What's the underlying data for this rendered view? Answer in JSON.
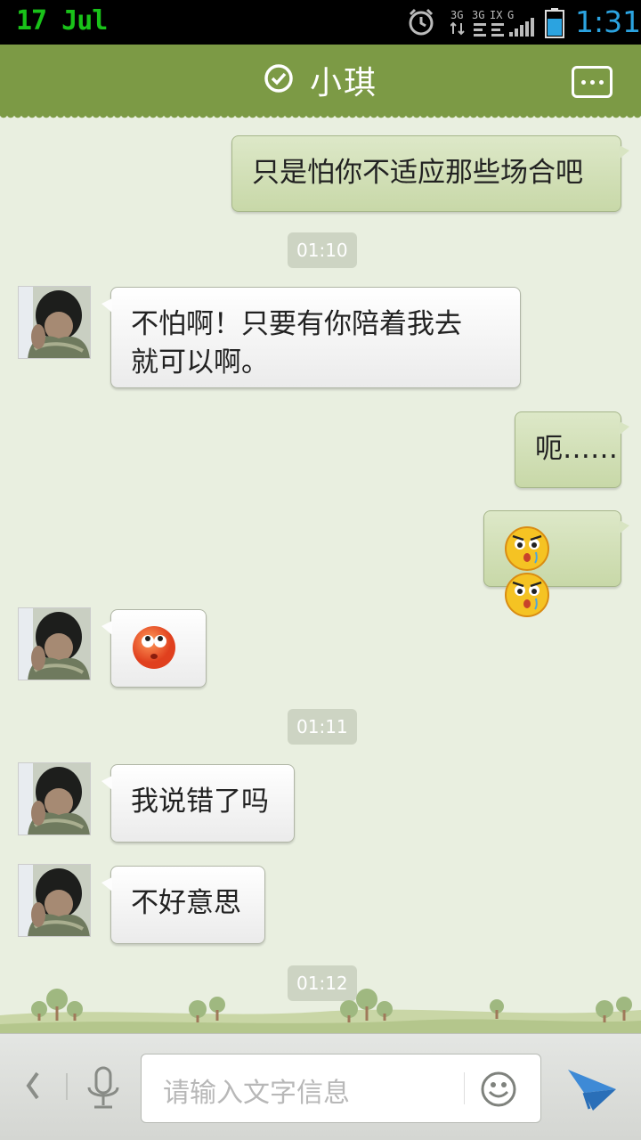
{
  "status_bar": {
    "date": "17  Jul",
    "time": "1:31",
    "network_label": "3G",
    "icons": [
      "alarm-icon",
      "network-icon",
      "signal-icon",
      "battery-icon"
    ]
  },
  "header": {
    "title": "小琪",
    "verified_icon": "check-circle-icon",
    "menu_icon": "more-icon"
  },
  "messages": [
    {
      "dir": "out",
      "text": "只是怕你不适应那些场合吧"
    },
    {
      "time": "01:10"
    },
    {
      "dir": "in",
      "text": "不怕啊！只要有你陪着我去就可以啊。"
    },
    {
      "dir": "out",
      "text": "呃……"
    },
    {
      "dir": "out",
      "emoji": [
        "angry-face-emoji",
        "angry-face-emoji"
      ]
    },
    {
      "dir": "in",
      "emoji": [
        "rolling-eyes-emoji"
      ]
    },
    {
      "time": "01:11"
    },
    {
      "dir": "in",
      "text": "我说错了吗"
    },
    {
      "dir": "in",
      "text": "不好意思"
    },
    {
      "time": "01:12"
    }
  ],
  "texts": {
    "m1": "只是怕你不适应那些场合吧",
    "ts1": "01:10",
    "m2_line1": "不怕啊！只要有你陪着我去",
    "m2_line2": "就可以啊。",
    "m3": "呃……",
    "ts2": "01:11",
    "m4": "我说错了吗",
    "m5": "不好意思",
    "ts3": "01:12"
  },
  "input_bar": {
    "placeholder": "请输入文字信息",
    "value": "",
    "back_icon": "chevron-left-icon",
    "mic_icon": "microphone-icon",
    "emoji_icon": "smiley-icon",
    "send_icon": "send-icon"
  },
  "colors": {
    "header": "#7c9a45",
    "background": "#e9efe0",
    "outgoing_bubble": "#d2deb8",
    "incoming_bubble": "#f5f5f5",
    "time_text": "#2ba3e0",
    "date_text": "#19c219"
  }
}
